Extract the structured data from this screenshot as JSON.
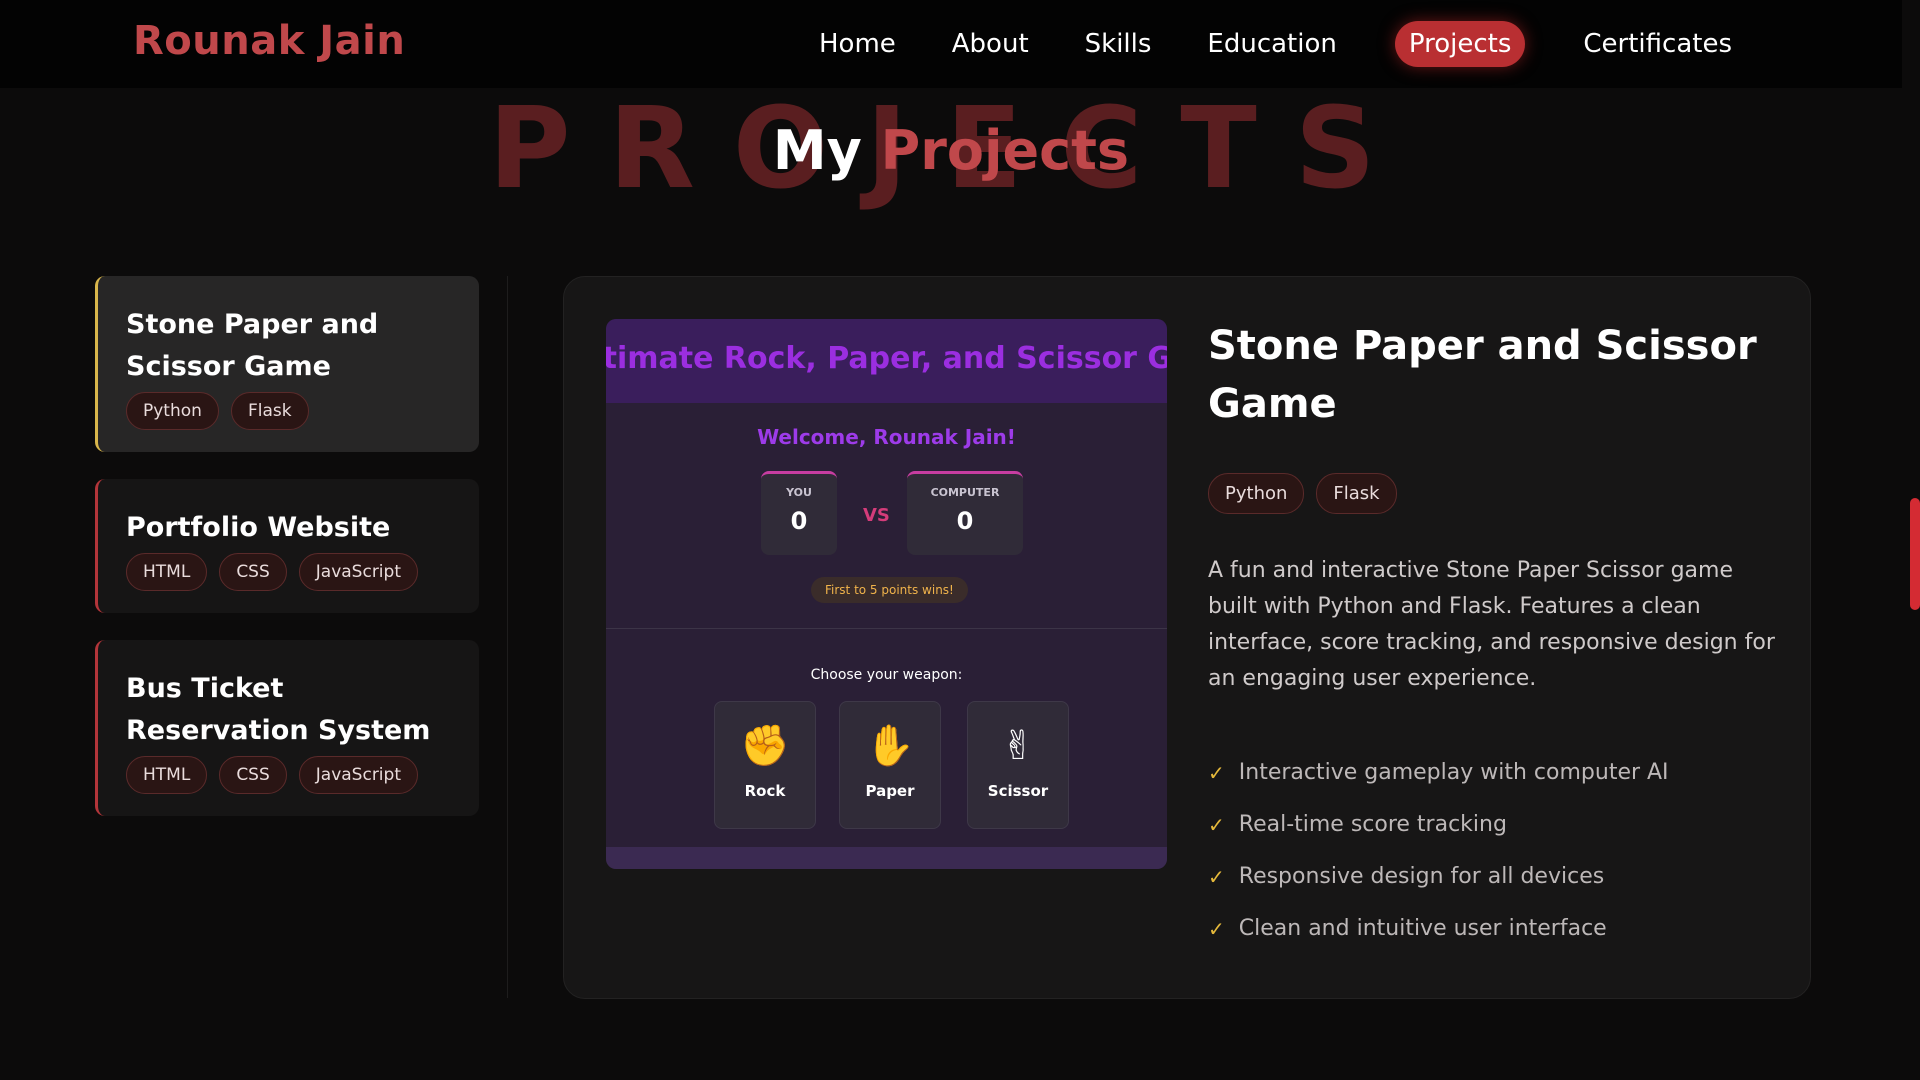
{
  "nav": {
    "brand": "Rounak Jain",
    "items": [
      {
        "label": "Home"
      },
      {
        "label": "About"
      },
      {
        "label": "Skills"
      },
      {
        "label": "Education"
      },
      {
        "label": "Projects",
        "active": true
      },
      {
        "label": "Certificates"
      }
    ]
  },
  "section": {
    "bg_word": "PROJECTS",
    "title_a": "My",
    "title_b": "Projects"
  },
  "projects": [
    {
      "title": "Stone Paper and Scissor Game",
      "tags": [
        "Python",
        "Flask"
      ],
      "selected": true
    },
    {
      "title": "Portfolio Website",
      "tags": [
        "HTML",
        "CSS",
        "JavaScript"
      ]
    },
    {
      "title": "Bus Ticket Reservation System",
      "tags": [
        "HTML",
        "CSS",
        "JavaScript"
      ]
    }
  ],
  "detail": {
    "title": "Stone Paper and Scissor Game",
    "tags": [
      "Python",
      "Flask"
    ],
    "description": "A fun and interactive Stone Paper Scissor game built with Python and Flask. Features a clean interface, score tracking, and responsive design for an engaging user experience.",
    "features": [
      "Interactive gameplay with computer AI",
      "Real-time score tracking",
      "Responsive design for all devices",
      "Clean and intuitive user interface"
    ],
    "screenshot": {
      "header": "Ultimate Rock, Paper, and Scissor Game",
      "welcome": "Welcome, Rounak Jain!",
      "you_label": "YOU",
      "you_score": "0",
      "vs": "VS",
      "comp_label": "COMPUTER",
      "comp_score": "0",
      "first_to": "First to 5 points wins!",
      "choose": "Choose your weapon:",
      "weapons": [
        {
          "label": "Rock",
          "icon": "✊"
        },
        {
          "label": "Paper",
          "icon": "✋"
        },
        {
          "label": "Scissor",
          "icon": "✌"
        }
      ]
    }
  },
  "colors": {
    "accent": "#c0484b",
    "active_nav": "#b92f32",
    "check": "#e5b93b"
  }
}
